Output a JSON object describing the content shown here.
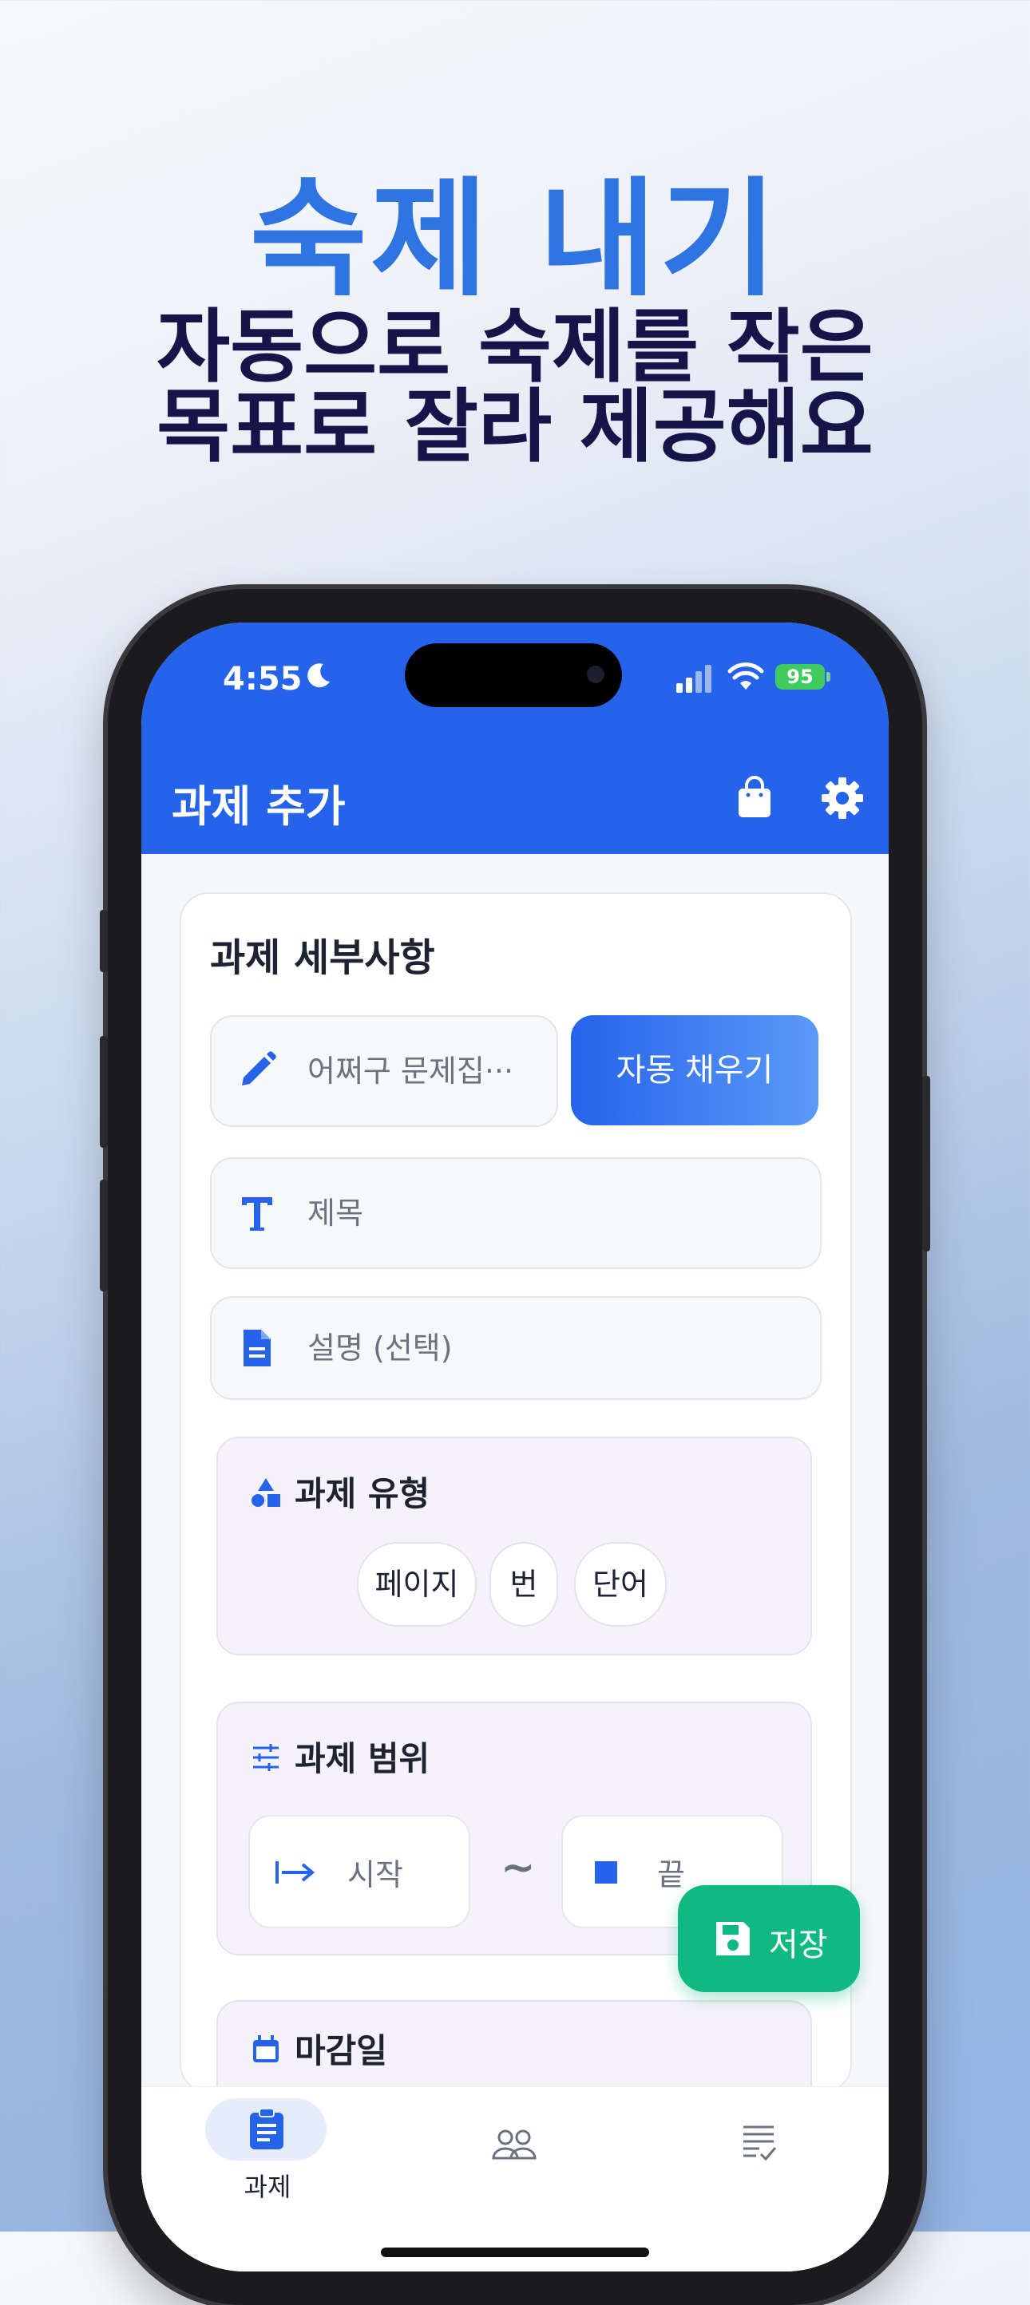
{
  "marketing": {
    "headline": "숙제 내기",
    "subline_1": "자동으로 숙제를 작은",
    "subline_2": "목표로 잘라 제공해요"
  },
  "status_bar": {
    "time": "4:55",
    "battery": "95"
  },
  "app_bar": {
    "title": "과제 추가",
    "icons": [
      "shopping-bag-icon",
      "gear-icon"
    ]
  },
  "card": {
    "title": "과제 세부사항",
    "source_field_placeholder": "어쩌구 문제집···",
    "autofill_label": "자동 채우기",
    "title_field_placeholder": "제목",
    "description_field_placeholder": "설명 (선택)",
    "type_section": {
      "title": "과제 유형",
      "options": [
        "페이지",
        "번",
        "단어"
      ]
    },
    "range_section": {
      "title": "과제 범위",
      "start_placeholder": "시작",
      "separator": "~",
      "end_placeholder": "끝"
    },
    "deadline_section": {
      "title": "마감일"
    }
  },
  "save_button": {
    "label": "저장"
  },
  "bottom_nav": {
    "items": [
      {
        "label": "과제",
        "icon": "clipboard-icon",
        "active": true
      },
      {
        "label": "",
        "icon": "people-icon",
        "active": false
      },
      {
        "label": "",
        "icon": "checklist-icon",
        "active": false
      }
    ]
  },
  "colors": {
    "primary": "#2563eb",
    "save": "#10b981",
    "headline": "#2f74e0",
    "subline": "#16154a"
  }
}
